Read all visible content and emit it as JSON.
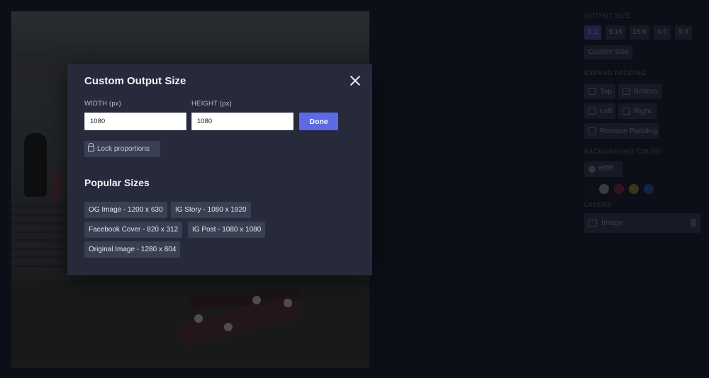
{
  "modal": {
    "title": "Custom Output Size",
    "width_label": "WIDTH (px)",
    "width_value": "1080",
    "height_label": "HEIGHT (px)",
    "height_value": "1080",
    "done_label": "Done",
    "lock_label": "Lock proportions",
    "popular_title": "Popular Sizes",
    "popular_sizes": [
      "OG Image - 1200 x 630",
      "IG Story - 1080 x 1920",
      "Facebook Cover - 820 x 312",
      "IG Post - 1080 x 1080",
      "Original Image - 1280 x 804"
    ]
  },
  "panel": {
    "output_size_label": "OUTPUT SIZE",
    "ratios": [
      "1:1",
      "9:16",
      "16:9",
      "4:5",
      "5:4"
    ],
    "custom_size_label": "Custom Size",
    "expand_padding_label": "EXPAND PADDING",
    "padding_options": [
      "Top",
      "Bottom",
      "Left",
      "Right",
      "Remove Padding"
    ],
    "background_color_label": "BACKGROUND COLOR",
    "background_color_value": "#ffffff",
    "swatches": [
      "#1a1a1a",
      "#d9d9d9",
      "#c81e2c",
      "#e2c21a",
      "#1f74d6"
    ],
    "layers_label": "LAYERS",
    "layer_name": "Image"
  },
  "colors": {
    "accent": "#5c6ae6",
    "modal_bg": "#262a3b",
    "button_bg": "#3a3f52"
  }
}
